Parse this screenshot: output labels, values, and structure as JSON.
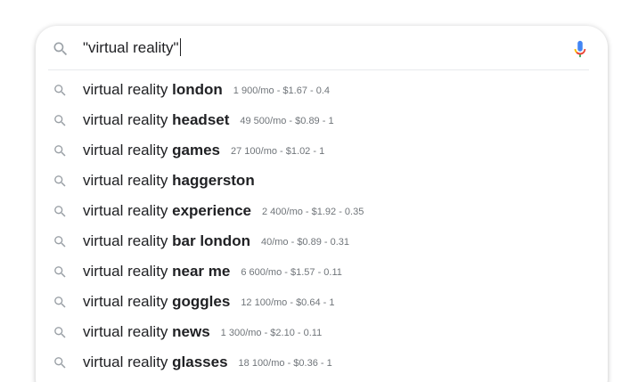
{
  "search": {
    "query": "\"virtual reality\""
  },
  "suggestions": [
    {
      "prefix": "virtual reality ",
      "bold": "london",
      "meta": "1 900/mo - $1.67 - 0.4"
    },
    {
      "prefix": "virtual reality ",
      "bold": "headset",
      "meta": "49 500/mo - $0.89 - 1"
    },
    {
      "prefix": "virtual reality ",
      "bold": "games",
      "meta": "27 100/mo - $1.02 - 1"
    },
    {
      "prefix": "virtual reality ",
      "bold": "haggerston",
      "meta": ""
    },
    {
      "prefix": "virtual reality ",
      "bold": "experience",
      "meta": "2 400/mo - $1.92 - 0.35"
    },
    {
      "prefix": "virtual reality ",
      "bold": "bar london",
      "meta": "40/mo - $0.89 - 0.31"
    },
    {
      "prefix": "virtual reality ",
      "bold": "near me",
      "meta": "6 600/mo - $1.57 - 0.11"
    },
    {
      "prefix": "virtual reality ",
      "bold": "goggles",
      "meta": "12 100/mo - $0.64 - 1"
    },
    {
      "prefix": "virtual reality ",
      "bold": "news",
      "meta": "1 300/mo - $2.10 - 0.11"
    },
    {
      "prefix": "virtual reality ",
      "bold": "glasses",
      "meta": "18 100/mo - $0.36 - 1"
    }
  ],
  "icons": {
    "search": "search-icon",
    "mic": "microphone-icon"
  },
  "colors": {
    "icon_gray": "#9aa0a6",
    "mic_blue": "#4285f4",
    "mic_red": "#ea4335",
    "mic_yellow": "#fbbc04",
    "mic_green": "#34a853"
  }
}
